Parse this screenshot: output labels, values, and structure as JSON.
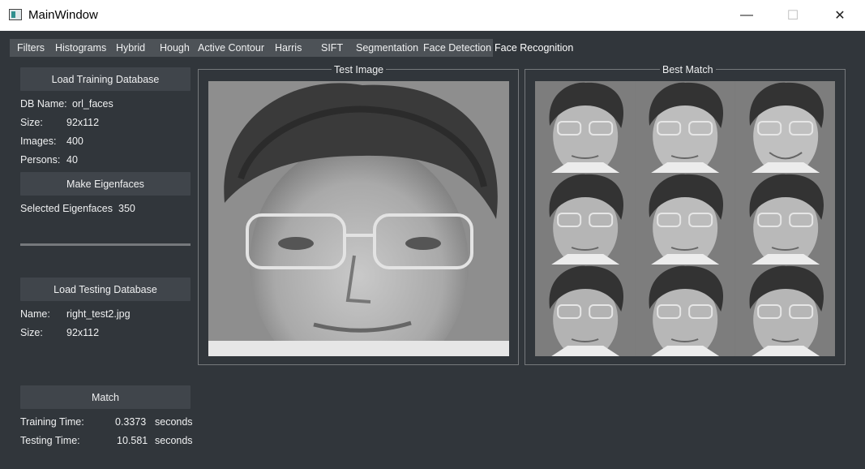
{
  "window": {
    "title": "MainWindow",
    "minimize": "—",
    "maximize": "☐",
    "close": "✕"
  },
  "tabs": [
    "Filters",
    "Histograms",
    "Hybrid",
    "Hough",
    "Active Contour",
    "Harris",
    "SIFT",
    "Segmentation",
    "Face Detection",
    "Face Recognition"
  ],
  "active_tab": "Face Recognition",
  "training": {
    "button": "Load Training Database",
    "db_name_label": "DB Name:",
    "db_name": "orl_faces",
    "size_label": "Size:",
    "size": "92x112",
    "images_label": "Images:",
    "images": "400",
    "persons_label": "Persons:",
    "persons": "40"
  },
  "eigen": {
    "button": "Make Eigenfaces",
    "selected_label": "Selected Eigenfaces",
    "selected": "350",
    "slider_fraction": 1.0
  },
  "testing": {
    "button": "Load Testing Database",
    "name_label": "Name:",
    "name": "right_test2.jpg",
    "size_label": "Size:",
    "size": "92x112"
  },
  "match": {
    "button": "Match",
    "training_time_label": "Training Time:",
    "training_time": "0.3373",
    "training_unit": "seconds",
    "testing_time_label": "Testing Time:",
    "testing_time": "10.581",
    "testing_unit": "seconds"
  },
  "panels": {
    "test_title": "Test Image",
    "best_title": "Best Match"
  },
  "colors": {
    "background": "#31363b",
    "button": "#40454b",
    "tabbar": "#4d5257",
    "border": "#76797c"
  }
}
